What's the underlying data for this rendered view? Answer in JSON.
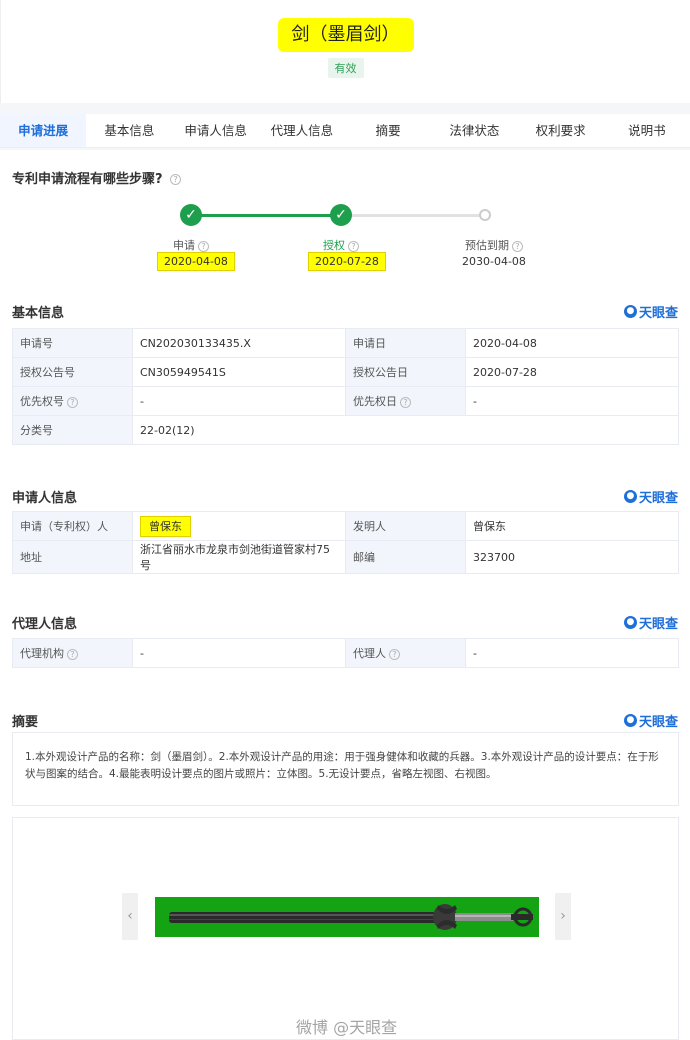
{
  "header": {
    "title": "剑（墨眉剑）",
    "status": "有效"
  },
  "tabs": [
    "申请进展",
    "基本信息",
    "申请人信息",
    "代理人信息",
    "摘要",
    "法律状态",
    "权利要求",
    "说明书"
  ],
  "progress": {
    "question": "专利申请流程有哪些步骤?",
    "steps": [
      {
        "label": "申请",
        "date": "2020-04-08"
      },
      {
        "label": "授权",
        "date": "2020-07-28"
      },
      {
        "label": "预估到期",
        "date": "2030-04-08"
      }
    ]
  },
  "brand": "天眼查",
  "basic_info": {
    "title": "基本信息",
    "rows": [
      [
        "申请号",
        "CN202030133435.X",
        "申请日",
        "2020-04-08"
      ],
      [
        "授权公告号",
        "CN305949541S",
        "授权公告日",
        "2020-07-28"
      ],
      [
        "优先权号",
        "-",
        "优先权日",
        "-"
      ],
      [
        "分类号",
        "22-02(12)"
      ]
    ]
  },
  "applicant_info": {
    "title": "申请人信息",
    "rows": [
      [
        "申请（专利权）人",
        "曾保东",
        "发明人",
        "曾保东"
      ],
      [
        "地址",
        "浙江省丽水市龙泉市剑池街道管家村75号",
        "邮编",
        "323700"
      ]
    ]
  },
  "agent_info": {
    "title": "代理人信息",
    "rows": [
      [
        "代理机构",
        "-",
        "代理人",
        "-"
      ]
    ]
  },
  "summary": {
    "title": "摘要",
    "text": "1.本外观设计产品的名称：剑（墨眉剑）。2.本外观设计产品的用途：用于强身健体和收藏的兵器。3.本外观设计产品的设计要点：在于形状与图案的结合。4.最能表明设计要点的图片或照片：立体图。5.无设计要点，省略左视图、右视图。"
  },
  "watermark": "微博 @天眼查",
  "colors": {
    "accent": "#1f6fd9",
    "success": "#1e9f4d",
    "highlight": "#ffff00"
  }
}
